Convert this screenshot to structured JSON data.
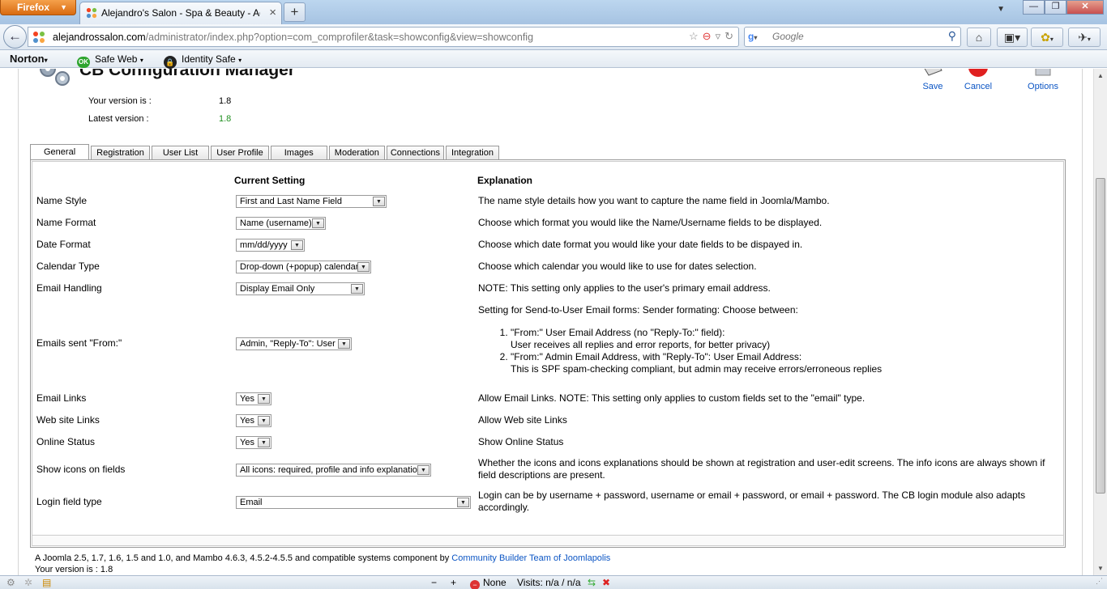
{
  "browser": {
    "app_button": "Firefox",
    "tab_title": "Alejandro's Salon - Spa & Beauty - Admi...",
    "url_domain": "alejandrossalon.com",
    "url_path": "/administrator/index.php?option=com_comprofiler&task=showconfig&view=showconfig",
    "search_placeholder": "Google"
  },
  "norton": {
    "brand": "Norton",
    "safe_web": "Safe Web",
    "safe_web_badge": "OK",
    "identity_safe": "Identity Safe"
  },
  "page": {
    "title": "CB Configuration Manager",
    "toolbar": {
      "save": "Save",
      "cancel": "Cancel",
      "options": "Options"
    },
    "your_version_label": "Your version is :",
    "your_version_value": "1.8",
    "latest_version_label": "Latest version :",
    "latest_version_value": "1.8",
    "tabs": [
      "General",
      "Registration",
      "User List",
      "User Profile",
      "Images",
      "Moderation",
      "Connections",
      "Integration"
    ],
    "headers": {
      "current": "Current Setting",
      "explanation": "Explanation"
    },
    "rows": [
      {
        "label": "Name Style",
        "value": "First and Last Name Field",
        "explanation": "The name style details how you want to capture the name field in Joomla/Mambo."
      },
      {
        "label": "Name Format",
        "value": "Name (username)",
        "explanation": "Choose which format you would like the Name/Username fields to be displayed."
      },
      {
        "label": "Date Format",
        "value": "mm/dd/yyyy",
        "explanation": "Choose which date format you would like your date fields to be dispayed in."
      },
      {
        "label": "Calendar Type",
        "value": "Drop-down (+popup) calendar",
        "explanation": "Choose which calendar you would like to use for dates selection."
      },
      {
        "label": "Email Handling",
        "value": "Display Email Only",
        "explanation": "NOTE: This setting only applies to the user's primary email address."
      },
      {
        "label": "Emails sent \"From:\"",
        "value": "Admin, \"Reply-To\": User",
        "explanation": "Setting for Send-to-User Email forms: Sender formating: Choose between:",
        "options": [
          {
            "line1": "\"From:\" User Email Address (no \"Reply-To:\" field):",
            "line2": "User receives all replies and error reports, for better privacy)"
          },
          {
            "line1": "\"From:\" Admin Email Address, with \"Reply-To\": User Email Address:",
            "line2": "This is SPF spam-checking compliant, but admin may receive errors/erroneous replies"
          }
        ]
      },
      {
        "label": "Email Links",
        "value": "Yes",
        "explanation": "Allow Email Links. NOTE: This setting only applies to custom fields set to the \"email\" type."
      },
      {
        "label": "Web site Links",
        "value": "Yes",
        "explanation": "Allow Web site Links"
      },
      {
        "label": "Online Status",
        "value": "Yes",
        "explanation": "Show Online Status"
      },
      {
        "label": "Show icons on fields",
        "value": "All icons: required, profile and info explanation",
        "explanation": "Whether the icons and icons explanations should be shown at registration and user-edit screens. The info icons are always shown if field descriptions are present."
      },
      {
        "label": "Login field type",
        "value": "Email",
        "explanation": "Login can be by username + password, username or email + password, or email + password. The CB login module also adapts accordingly."
      }
    ],
    "footer_text": "A Joomla 2.5, 1.7, 1.6, 1.5 and 1.0, and Mambo 4.6.3, 4.5.2-4.5.5 and compatible systems component by ",
    "footer_link": "Community Builder Team of Joomlapolis",
    "footer_version": "Your version is : 1.8"
  },
  "statusbar": {
    "zoom_out": "−",
    "zoom_in": "+",
    "none_label": "None",
    "visits": "Visits: n/a / n/a"
  }
}
